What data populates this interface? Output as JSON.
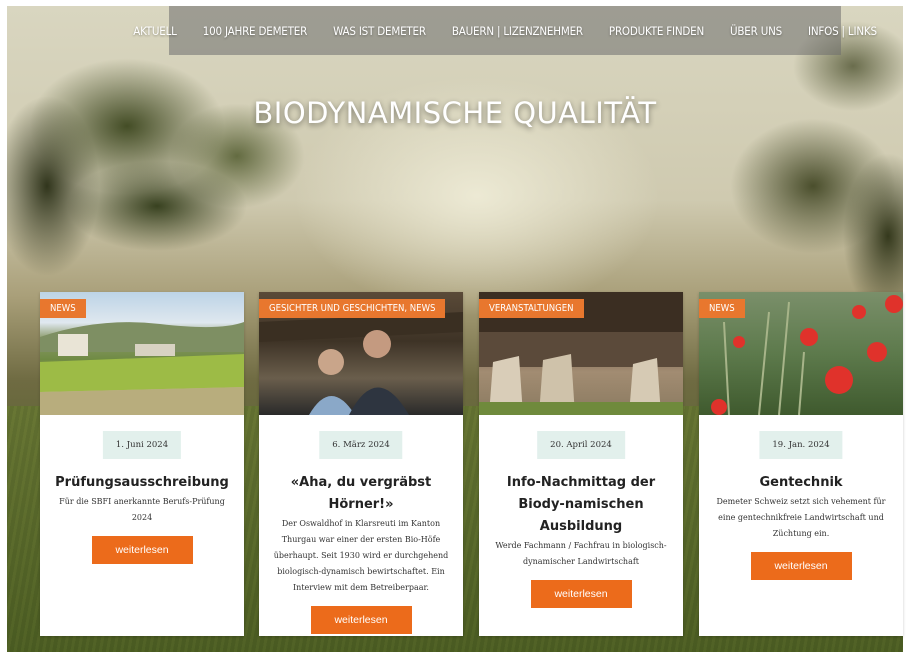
{
  "nav": {
    "items": [
      "AKTUELL",
      "100 JAHRE DEMETER",
      "WAS IST DEMETER",
      "BAUERN | LIZENZNEHMER",
      "PRODUKTE FINDEN",
      "ÜBER UNS",
      "INFOS | LINKS"
    ]
  },
  "hero": {
    "title": "BIODYNAMISCHE QUALITÄT"
  },
  "cards": [
    {
      "tag": "NEWS",
      "date": "1. Juni 2024",
      "title": "Prüfungsausschreibung",
      "excerpt": "Für die SBFI anerkannte Berufs-Prüfung 2024",
      "button": "weiterlesen"
    },
    {
      "tag": "GESICHTER UND GESCHICHTEN, NEWS",
      "date": "6. März 2024",
      "title": "«Aha, du vergräbst Hörner!»",
      "excerpt": "Der Oswaldhof in Klarsreuti im Kanton Thurgau war einer der ersten Bio-Höfe überhaupt. Seit 1930 wird er durchgehend biologisch-dynamisch bewirtschaftet. Ein Interview mit dem Betreiberpaar.",
      "button": "weiterlesen"
    },
    {
      "tag": "VERANSTALTUNGEN",
      "date": "20. April 2024",
      "title": "Info-Nachmittag der Biody-namischen Ausbildung",
      "excerpt": "Werde Fachmann / Fachfrau in biologisch-dynamischer Landwirtschaft",
      "button": "weiterlesen"
    },
    {
      "tag": "NEWS",
      "date": "19. Jan. 2024",
      "title": "Gentechnik",
      "excerpt": "Demeter Schweiz setzt sich vehement für eine gentechnikfreie Landwirtschaft und Züchtung ein.",
      "button": "weiterlesen"
    }
  ],
  "colors": {
    "accent": "#ec6b1b",
    "tag": "#e8772e",
    "date_bg": "#e2f0ec"
  }
}
